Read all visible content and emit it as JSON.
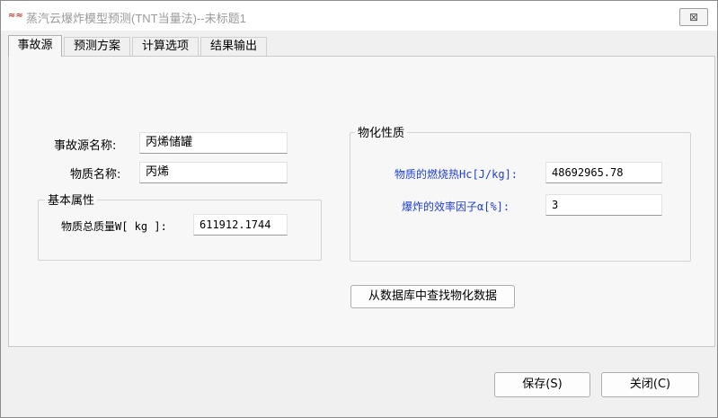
{
  "window": {
    "title": "蒸汽云爆炸模型预测(TNT当量法)--未标题1",
    "close_symbol": "⊠"
  },
  "tabs": [
    {
      "label": "事故源",
      "active": true
    },
    {
      "label": "预测方案",
      "active": false
    },
    {
      "label": "计算选项",
      "active": false
    },
    {
      "label": "结果输出",
      "active": false
    }
  ],
  "source": {
    "name_label": "事故源名称:",
    "name_value": "丙烯储罐",
    "material_label": "物质名称:",
    "material_value": "丙烯"
  },
  "basic": {
    "group_title": "基本属性",
    "mass_label": "物质总质量W[ kg ]:",
    "mass_value": "611912.1744"
  },
  "physchem": {
    "group_title": "物化性质",
    "heat_label": "物质的燃烧热Hc[J/kg]:",
    "heat_value": "48692965.78",
    "efficiency_label": "爆炸的效率因子α[%]:",
    "efficiency_value": "3",
    "lookup_button": "从数据库中查找物化数据"
  },
  "footer": {
    "save_button": "保存(S)",
    "close_button": "关闭(C)"
  },
  "colors": {
    "accent_label": "#1f3fd6",
    "title_text": "#9a9a9a",
    "icon": "#c0392b"
  }
}
